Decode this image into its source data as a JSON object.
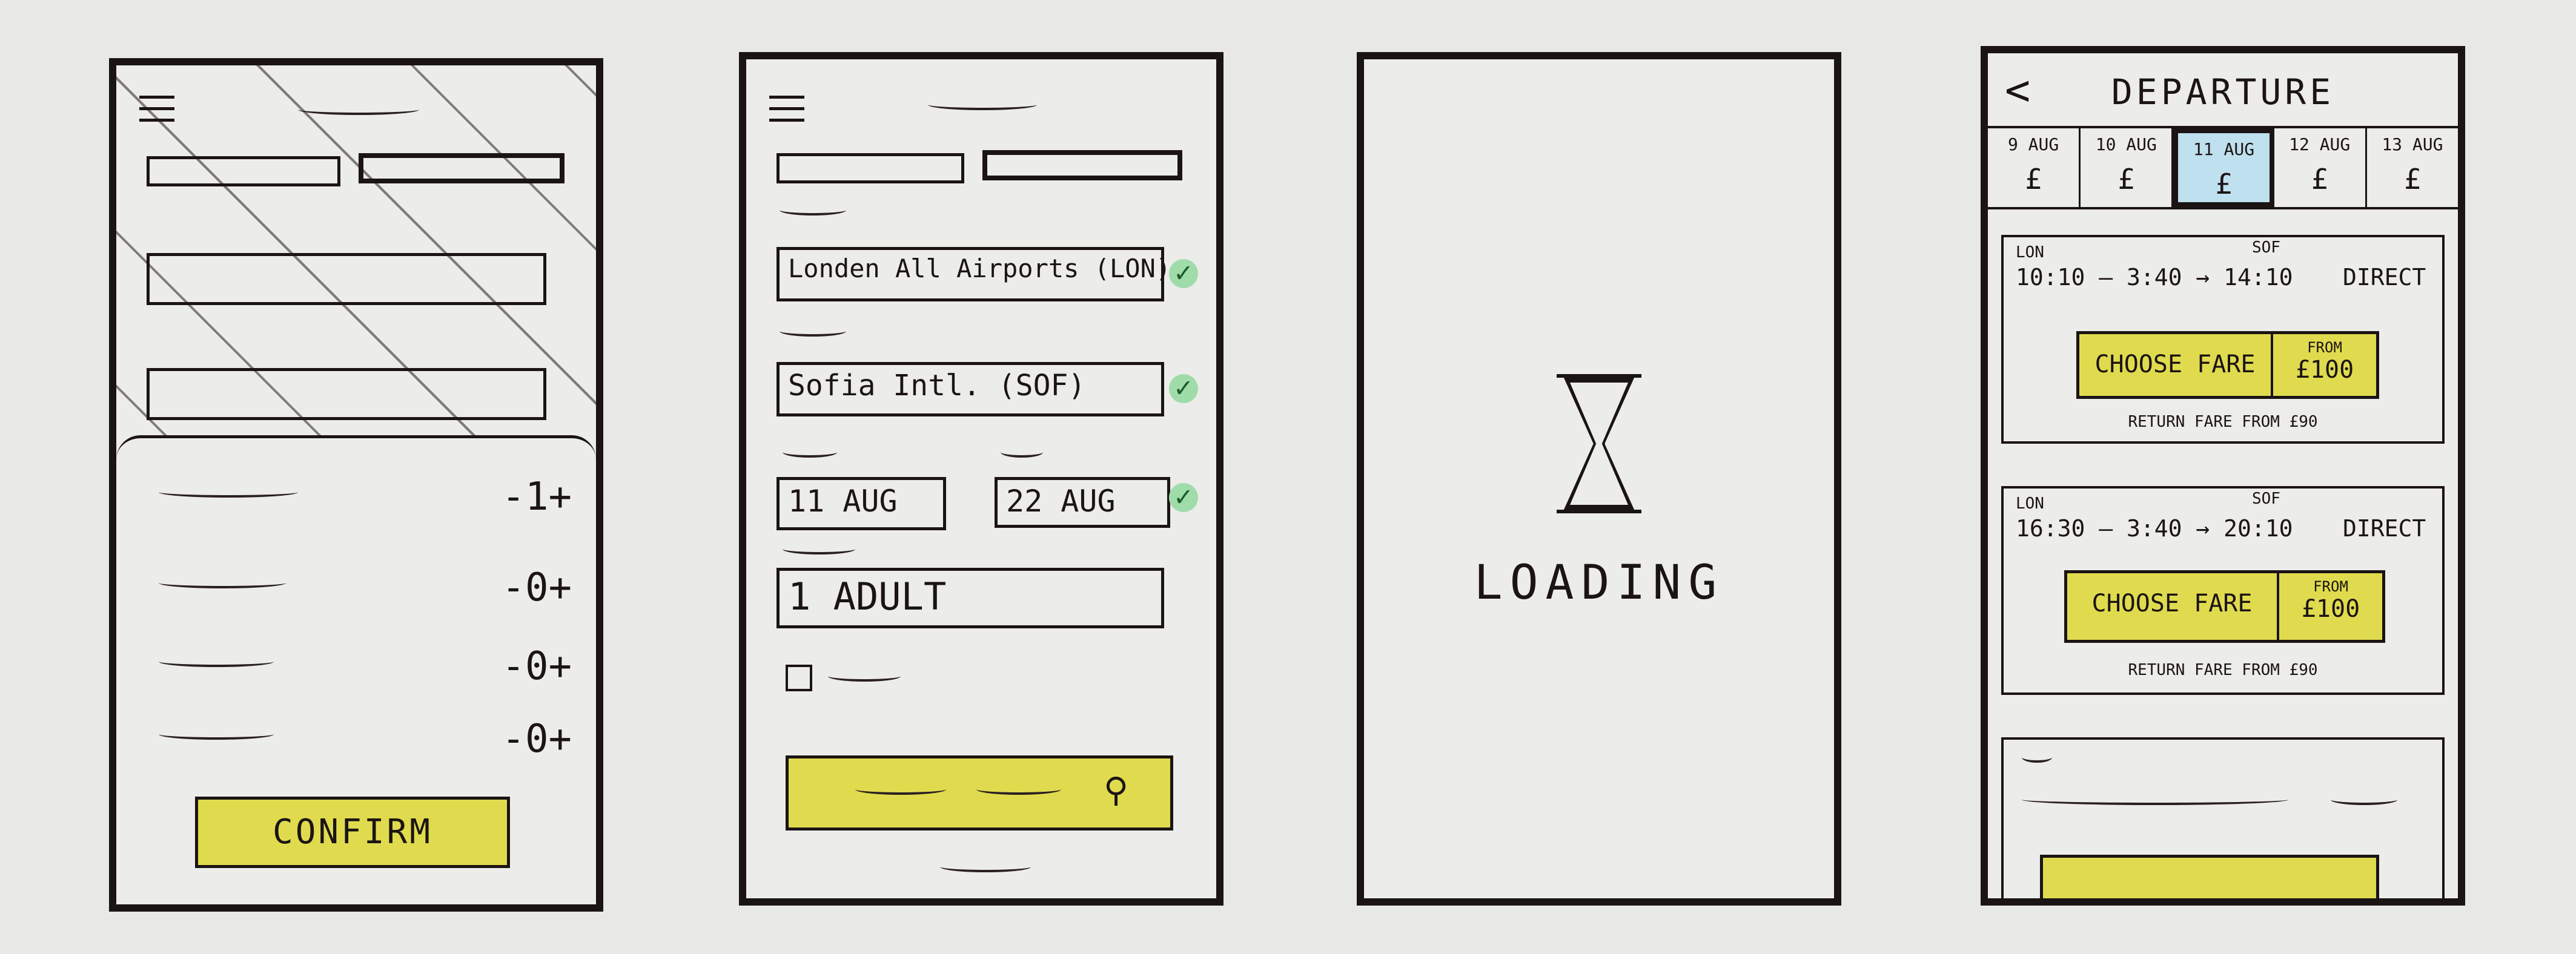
{
  "screen1": {
    "counters": [
      {
        "value": "-1+"
      },
      {
        "value": "-0+"
      },
      {
        "value": "-0+"
      },
      {
        "value": "-0+"
      }
    ],
    "confirm_label": "CONFIRM"
  },
  "screen2": {
    "from_value": "Londen All Airports (LON)",
    "to_value": "Sofia Intl. (SOF)",
    "depart_date": "11 AUG",
    "return_date": "22 AUG",
    "passengers": "1 ADULT",
    "check_mark": "✓"
  },
  "screen3": {
    "loading_text": "LOADING"
  },
  "screen4": {
    "title": "DEPARTURE",
    "back_glyph": "<",
    "dates": [
      {
        "date": "9 AUG",
        "price": "£"
      },
      {
        "date": "10 AUG",
        "price": "£"
      },
      {
        "date": "11 AUG",
        "price": "£",
        "selected": true
      },
      {
        "date": "12 AUG",
        "price": "£"
      },
      {
        "date": "13 AUG",
        "price": "£"
      }
    ],
    "flights": [
      {
        "from": "LON",
        "to": "SOF",
        "times": "10:10 — 3:40 → 14:10",
        "type": "DIRECT",
        "choose_label": "CHOOSE FARE",
        "from_label": "FROM",
        "price": "£100",
        "return_fare": "RETURN FARE FROM £90"
      },
      {
        "from": "LON",
        "to": "SOF",
        "times": "16:30 — 3:40 → 20:10",
        "type": "DIRECT",
        "choose_label": "CHOOSE FARE",
        "from_label": "FROM",
        "price": "£100",
        "return_fare": "RETURN FARE FROM £90"
      }
    ]
  },
  "colors": {
    "ink": "#1b1414",
    "accent_yellow": "#e0db4e",
    "check_green": "#9fdcaa",
    "selected_blue": "#bfe0ee"
  }
}
